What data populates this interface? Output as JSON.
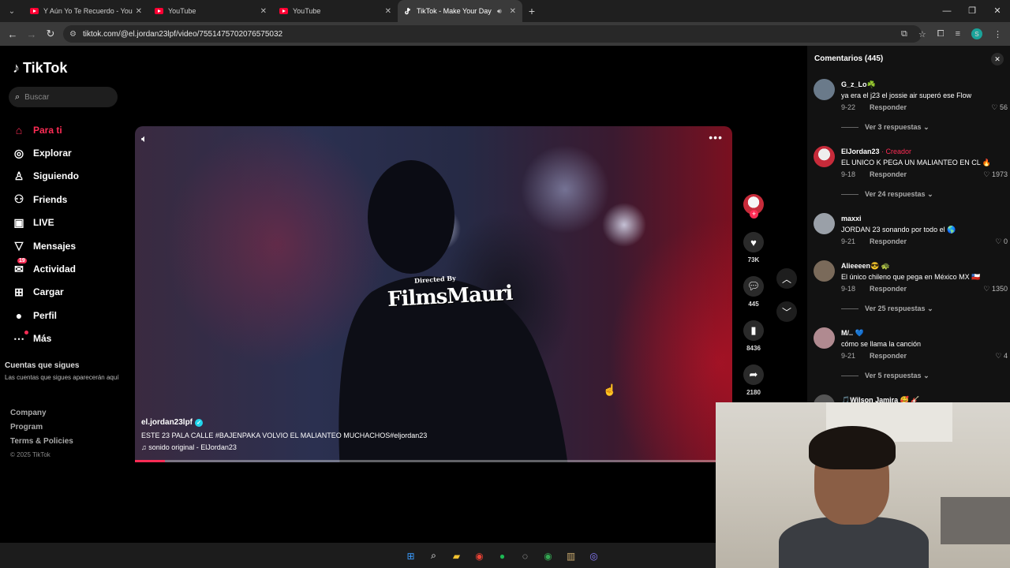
{
  "browser": {
    "tabs": [
      {
        "title": "Y Aún Yo Te Recuerdo - YouTube",
        "icon": "youtube-icon"
      },
      {
        "title": "YouTube",
        "icon": "youtube-icon"
      },
      {
        "title": "YouTube",
        "icon": "youtube-icon"
      },
      {
        "title": "TikTok - Make Your Day",
        "icon": "tiktok-icon",
        "active": true
      }
    ],
    "url": "tiktok.com/@el.jordan23lpf/video/7551475702076575032",
    "profile_initial": "s"
  },
  "tiktok": {
    "brand": "TikTok",
    "search_placeholder": "Buscar",
    "nav": [
      {
        "label": "Para ti",
        "icon": "home-icon"
      },
      {
        "label": "Explorar",
        "icon": "compass-icon"
      },
      {
        "label": "Siguiendo",
        "icon": "following-icon"
      },
      {
        "label": "Friends",
        "icon": "friends-icon"
      },
      {
        "label": "LIVE",
        "icon": "live-icon"
      },
      {
        "label": "Mensajes",
        "icon": "messages-icon"
      },
      {
        "label": "Actividad",
        "icon": "activity-icon",
        "badge": "19"
      },
      {
        "label": "Cargar",
        "icon": "upload-icon"
      },
      {
        "label": "Perfil",
        "icon": "profile-icon"
      },
      {
        "label": "Más",
        "icon": "more-icon"
      }
    ],
    "following_header": "Cuentas que sigues",
    "following_sub": "Las cuentas que sigues aparecerán aquí",
    "footer": [
      "Company",
      "Program",
      "Terms & Policies"
    ],
    "copyright": "© 2025 TikTok"
  },
  "video": {
    "overlay_small": "Directed By",
    "overlay_big": "FilmsMauri",
    "author": "el.jordan23lpf",
    "description": "ESTE 23 PALA CALLE #BAJENPAKA  VOLVIO EL MALIANTEO MUCHACHOS#eljordan23",
    "sound": "sonido original - ElJordan23",
    "progress": 0.05
  },
  "actions": {
    "likes": "73K",
    "comments": "445",
    "saves": "8436",
    "shares": "2180"
  },
  "comments_panel": {
    "title": "Comentarios (445)",
    "items": [
      {
        "user": "G_z_Lo☘️",
        "text": "ya era el j23 el jossie air superó ese Flow",
        "date": "9-22",
        "reply": "Responder",
        "likes": "56",
        "more": "Ver 3 respuestas",
        "avatar_color": "#6a7a8a"
      },
      {
        "user": "ElJordan23",
        "creator": " · Creador",
        "text": "EL UNICO K PEGA UN MALIANTEO EN CL 🔥",
        "date": "9-18",
        "reply": "Responder",
        "likes": "1973",
        "more": "Ver 24 respuestas",
        "avatar_color": "#c72b3a"
      },
      {
        "user": "maxxi",
        "text": "JORDAN 23 sonando por todo el 🌎",
        "date": "9-21",
        "reply": "Responder",
        "likes": "0",
        "more": "",
        "avatar_color": "#9aa0a8"
      },
      {
        "user": "Alieeeen😎 🐢",
        "text": "El único chileno que pega en México MX 🇨🇱",
        "date": "9-18",
        "reply": "Responder",
        "likes": "1350",
        "more": "Ver 25 respuestas",
        "avatar_color": "#7a6a5a"
      },
      {
        "user": "M/.. 💙",
        "text": "cómo se llama la canción",
        "date": "9-21",
        "reply": "Responder",
        "likes": "4",
        "more": "Ver 5 respuestas",
        "avatar_color": "#b08a90"
      },
      {
        "user": "🎵Wilson Jamira 🥰 🎸",
        "text": "",
        "date": "",
        "reply": "",
        "likes": "",
        "more": "",
        "avatar_color": "#555"
      }
    ]
  },
  "taskbar": {
    "icons": [
      "windows-icon",
      "search-icon",
      "folder-icon",
      "chrome-icon",
      "spotify-icon",
      "obs-icon",
      "chrome-alt-icon",
      "files-icon",
      "app-icon"
    ]
  }
}
